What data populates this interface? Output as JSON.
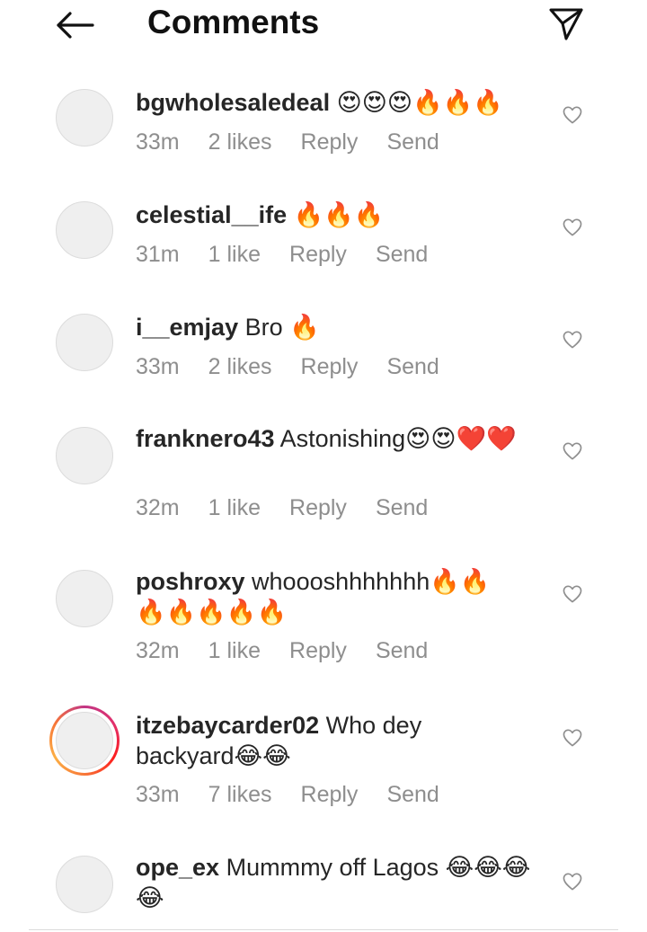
{
  "header": {
    "title": "Comments",
    "back_icon": "arrow-left-icon",
    "send_icon": "paper-plane-icon"
  },
  "comments": [
    {
      "username": "bgwholesaledeal",
      "text": "😍😍😍🔥🔥🔥",
      "time": "33m",
      "likes": "2 likes",
      "reply": "Reply",
      "send": "Send"
    },
    {
      "username": "celestial__ife",
      "text": "🔥🔥🔥",
      "time": "31m",
      "likes": "1 like",
      "reply": "Reply",
      "send": "Send"
    },
    {
      "username": "i__emjay",
      "text": "Bro 🔥",
      "time": "33m",
      "likes": "2 likes",
      "reply": "Reply",
      "send": "Send"
    },
    {
      "username": "franknero43",
      "text": "Astonishing😍😍❤️❤️",
      "time": "32m",
      "likes": "1 like",
      "reply": "Reply",
      "send": "Send"
    },
    {
      "username": "poshroxy",
      "text": "whoooshhhhhhh🔥🔥🔥🔥🔥🔥🔥",
      "time": "32m",
      "likes": "1 like",
      "reply": "Reply",
      "send": "Send"
    },
    {
      "username": "itzebaycarder02",
      "text": "Who dey backyard😂😂",
      "time": "33m",
      "likes": "7 likes",
      "reply": "Reply",
      "send": "Send"
    },
    {
      "username": "ope_ex",
      "text": "Mummmy off Lagos 😂😂😂😂",
      "time": "",
      "likes": "",
      "reply": "",
      "send": ""
    }
  ],
  "colors": {
    "text": "#262626",
    "meta": "#8e8e8e",
    "story_ring": "#e1306c"
  }
}
